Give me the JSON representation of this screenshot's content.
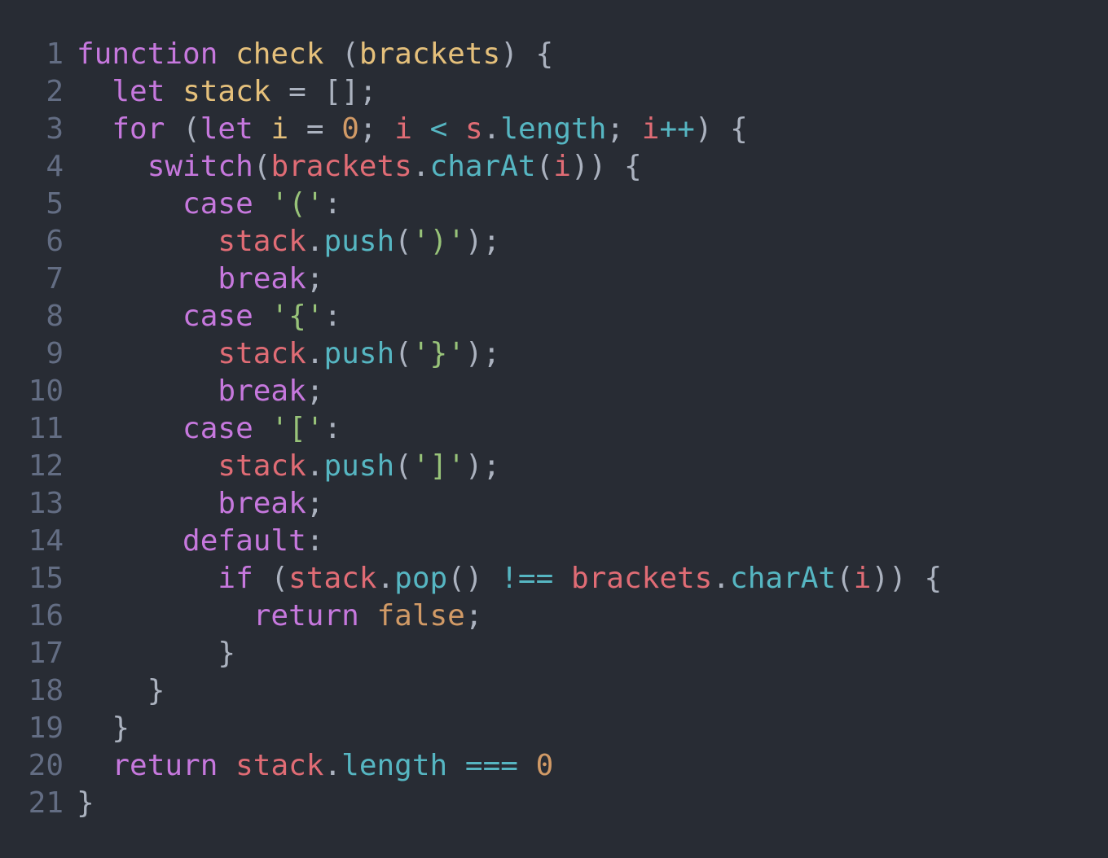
{
  "colors": {
    "background": "#282c34",
    "line_number": "#636d83",
    "keyword": "#c678dd",
    "definition": "#e5c07b",
    "plain": "#abb2bf",
    "variable": "#e06c75",
    "property": "#56b6c2",
    "number": "#d19a66",
    "string": "#98c379"
  },
  "lines": [
    {
      "num": "1",
      "tokens": [
        {
          "t": "function",
          "k": "keyword"
        },
        {
          "t": " ",
          "k": "plain"
        },
        {
          "t": "check",
          "k": "def"
        },
        {
          "t": " (",
          "k": "plain"
        },
        {
          "t": "brackets",
          "k": "def"
        },
        {
          "t": ") {",
          "k": "plain"
        }
      ]
    },
    {
      "num": "2",
      "tokens": [
        {
          "t": "  ",
          "k": "plain"
        },
        {
          "t": "let",
          "k": "keyword"
        },
        {
          "t": " ",
          "k": "plain"
        },
        {
          "t": "stack",
          "k": "def"
        },
        {
          "t": " = [];",
          "k": "plain"
        }
      ]
    },
    {
      "num": "3",
      "tokens": [
        {
          "t": "  ",
          "k": "plain"
        },
        {
          "t": "for",
          "k": "keyword"
        },
        {
          "t": " (",
          "k": "plain"
        },
        {
          "t": "let",
          "k": "keyword"
        },
        {
          "t": " ",
          "k": "plain"
        },
        {
          "t": "i",
          "k": "def"
        },
        {
          "t": " = ",
          "k": "plain"
        },
        {
          "t": "0",
          "k": "num"
        },
        {
          "t": "; ",
          "k": "plain"
        },
        {
          "t": "i",
          "k": "var"
        },
        {
          "t": " ",
          "k": "plain"
        },
        {
          "t": "<",
          "k": "op"
        },
        {
          "t": " ",
          "k": "plain"
        },
        {
          "t": "s",
          "k": "var"
        },
        {
          "t": ".",
          "k": "plain"
        },
        {
          "t": "length",
          "k": "prop"
        },
        {
          "t": "; ",
          "k": "plain"
        },
        {
          "t": "i",
          "k": "var"
        },
        {
          "t": "++",
          "k": "op"
        },
        {
          "t": ") {",
          "k": "plain"
        }
      ]
    },
    {
      "num": "4",
      "tokens": [
        {
          "t": "    ",
          "k": "plain"
        },
        {
          "t": "switch",
          "k": "keyword"
        },
        {
          "t": "(",
          "k": "plain"
        },
        {
          "t": "brackets",
          "k": "var"
        },
        {
          "t": ".",
          "k": "plain"
        },
        {
          "t": "charAt",
          "k": "prop"
        },
        {
          "t": "(",
          "k": "plain"
        },
        {
          "t": "i",
          "k": "var"
        },
        {
          "t": ")) {",
          "k": "plain"
        }
      ]
    },
    {
      "num": "5",
      "tokens": [
        {
          "t": "      ",
          "k": "plain"
        },
        {
          "t": "case",
          "k": "keyword"
        },
        {
          "t": " ",
          "k": "plain"
        },
        {
          "t": "'('",
          "k": "string"
        },
        {
          "t": ":",
          "k": "plain"
        }
      ]
    },
    {
      "num": "6",
      "tokens": [
        {
          "t": "        ",
          "k": "plain"
        },
        {
          "t": "stack",
          "k": "var"
        },
        {
          "t": ".",
          "k": "plain"
        },
        {
          "t": "push",
          "k": "prop"
        },
        {
          "t": "(",
          "k": "plain"
        },
        {
          "t": "')'",
          "k": "string"
        },
        {
          "t": ");",
          "k": "plain"
        }
      ]
    },
    {
      "num": "7",
      "tokens": [
        {
          "t": "        ",
          "k": "plain"
        },
        {
          "t": "break",
          "k": "keyword"
        },
        {
          "t": ";",
          "k": "plain"
        }
      ]
    },
    {
      "num": "8",
      "tokens": [
        {
          "t": "      ",
          "k": "plain"
        },
        {
          "t": "case",
          "k": "keyword"
        },
        {
          "t": " ",
          "k": "plain"
        },
        {
          "t": "'{'",
          "k": "string"
        },
        {
          "t": ":",
          "k": "plain"
        }
      ]
    },
    {
      "num": "9",
      "tokens": [
        {
          "t": "        ",
          "k": "plain"
        },
        {
          "t": "stack",
          "k": "var"
        },
        {
          "t": ".",
          "k": "plain"
        },
        {
          "t": "push",
          "k": "prop"
        },
        {
          "t": "(",
          "k": "plain"
        },
        {
          "t": "'}'",
          "k": "string"
        },
        {
          "t": ");",
          "k": "plain"
        }
      ]
    },
    {
      "num": "10",
      "tokens": [
        {
          "t": "        ",
          "k": "plain"
        },
        {
          "t": "break",
          "k": "keyword"
        },
        {
          "t": ";",
          "k": "plain"
        }
      ]
    },
    {
      "num": "11",
      "tokens": [
        {
          "t": "      ",
          "k": "plain"
        },
        {
          "t": "case",
          "k": "keyword"
        },
        {
          "t": " ",
          "k": "plain"
        },
        {
          "t": "'['",
          "k": "string"
        },
        {
          "t": ":",
          "k": "plain"
        }
      ]
    },
    {
      "num": "12",
      "tokens": [
        {
          "t": "        ",
          "k": "plain"
        },
        {
          "t": "stack",
          "k": "var"
        },
        {
          "t": ".",
          "k": "plain"
        },
        {
          "t": "push",
          "k": "prop"
        },
        {
          "t": "(",
          "k": "plain"
        },
        {
          "t": "']'",
          "k": "string"
        },
        {
          "t": ");",
          "k": "plain"
        }
      ]
    },
    {
      "num": "13",
      "tokens": [
        {
          "t": "        ",
          "k": "plain"
        },
        {
          "t": "break",
          "k": "keyword"
        },
        {
          "t": ";",
          "k": "plain"
        }
      ]
    },
    {
      "num": "14",
      "tokens": [
        {
          "t": "      ",
          "k": "plain"
        },
        {
          "t": "default",
          "k": "keyword"
        },
        {
          "t": ":",
          "k": "plain"
        }
      ]
    },
    {
      "num": "15",
      "tokens": [
        {
          "t": "        ",
          "k": "plain"
        },
        {
          "t": "if",
          "k": "keyword"
        },
        {
          "t": " (",
          "k": "plain"
        },
        {
          "t": "stack",
          "k": "var"
        },
        {
          "t": ".",
          "k": "plain"
        },
        {
          "t": "pop",
          "k": "prop"
        },
        {
          "t": "() ",
          "k": "plain"
        },
        {
          "t": "!==",
          "k": "op"
        },
        {
          "t": " ",
          "k": "plain"
        },
        {
          "t": "brackets",
          "k": "var"
        },
        {
          "t": ".",
          "k": "plain"
        },
        {
          "t": "charAt",
          "k": "prop"
        },
        {
          "t": "(",
          "k": "plain"
        },
        {
          "t": "i",
          "k": "var"
        },
        {
          "t": ")) {",
          "k": "plain"
        }
      ]
    },
    {
      "num": "16",
      "tokens": [
        {
          "t": "          ",
          "k": "plain"
        },
        {
          "t": "return",
          "k": "keyword"
        },
        {
          "t": " ",
          "k": "plain"
        },
        {
          "t": "false",
          "k": "bool"
        },
        {
          "t": ";",
          "k": "plain"
        }
      ]
    },
    {
      "num": "17",
      "tokens": [
        {
          "t": "        }",
          "k": "plain"
        }
      ]
    },
    {
      "num": "18",
      "tokens": [
        {
          "t": "    }",
          "k": "plain"
        }
      ]
    },
    {
      "num": "19",
      "tokens": [
        {
          "t": "  }",
          "k": "plain"
        }
      ]
    },
    {
      "num": "20",
      "tokens": [
        {
          "t": "  ",
          "k": "plain"
        },
        {
          "t": "return",
          "k": "keyword"
        },
        {
          "t": " ",
          "k": "plain"
        },
        {
          "t": "stack",
          "k": "var"
        },
        {
          "t": ".",
          "k": "plain"
        },
        {
          "t": "length",
          "k": "prop"
        },
        {
          "t": " ",
          "k": "plain"
        },
        {
          "t": "===",
          "k": "op"
        },
        {
          "t": " ",
          "k": "plain"
        },
        {
          "t": "0",
          "k": "num"
        }
      ]
    },
    {
      "num": "21",
      "tokens": [
        {
          "t": "}",
          "k": "plain"
        }
      ]
    }
  ]
}
